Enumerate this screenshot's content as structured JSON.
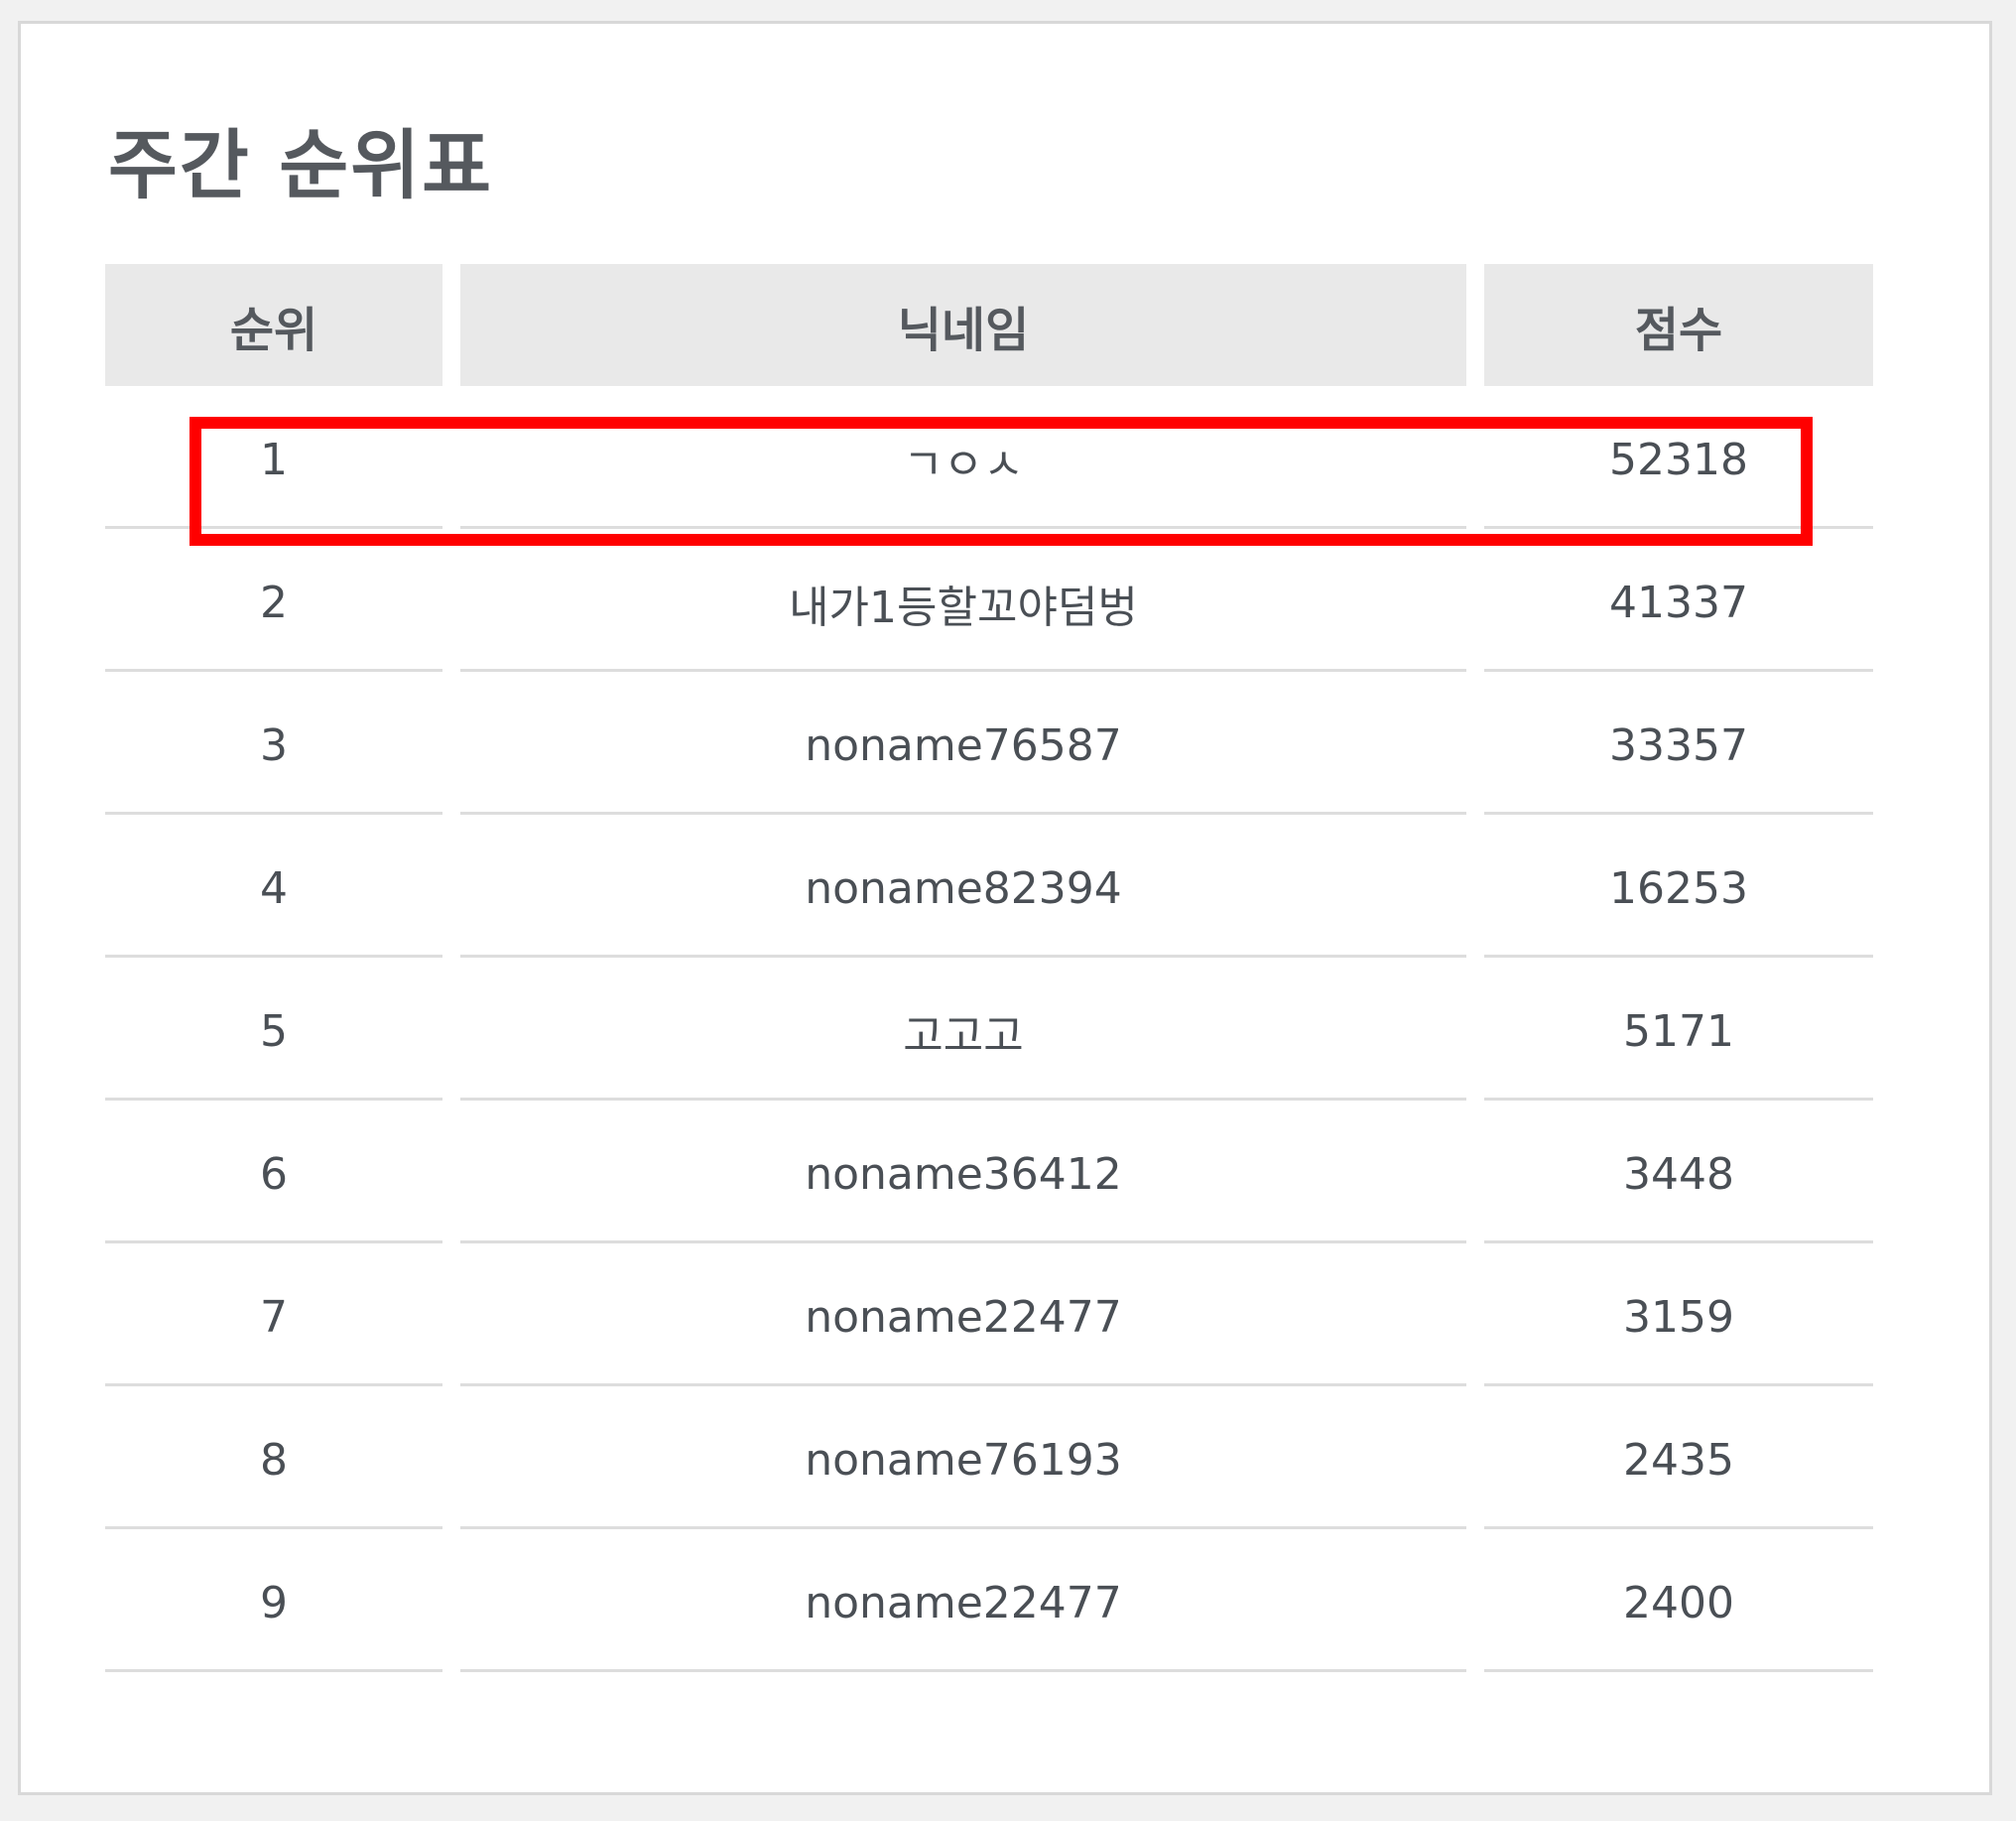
{
  "panel": {
    "title": "주간 순위표"
  },
  "table": {
    "columns": [
      "순위",
      "닉네임",
      "점수"
    ],
    "rows": [
      {
        "rank": "1",
        "nickname": "ㄱㅇㅅ",
        "score": "52318"
      },
      {
        "rank": "2",
        "nickname": "내가1등할꼬야덤벙",
        "score": "41337"
      },
      {
        "rank": "3",
        "nickname": "noname76587",
        "score": "33357"
      },
      {
        "rank": "4",
        "nickname": "noname82394",
        "score": "16253"
      },
      {
        "rank": "5",
        "nickname": "고고고",
        "score": "5171"
      },
      {
        "rank": "6",
        "nickname": "noname36412",
        "score": "3448"
      },
      {
        "rank": "7",
        "nickname": "noname22477",
        "score": "3159"
      },
      {
        "rank": "8",
        "nickname": "noname76193",
        "score": "2435"
      },
      {
        "rank": "9",
        "nickname": "noname22477",
        "score": "2400"
      }
    ]
  },
  "colors": {
    "highlight": "#ff0000",
    "header_bg": "#e9e9e9",
    "text": "#4a4f55"
  }
}
